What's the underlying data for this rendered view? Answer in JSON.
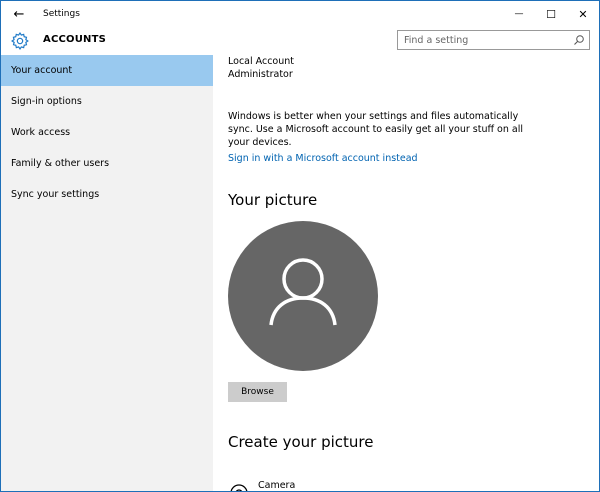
{
  "titlebar": {
    "title": "Settings",
    "back_glyph": "←",
    "minimize_glyph": "—",
    "maximize_glyph": "☐",
    "close_glyph": "✕"
  },
  "header": {
    "section_title": "ACCOUNTS",
    "icon": "gear-icon",
    "search_placeholder": "Find a setting"
  },
  "sidebar": {
    "items": [
      {
        "label": "Your account",
        "active": true
      },
      {
        "label": "Sign-in options",
        "active": false
      },
      {
        "label": "Work access",
        "active": false
      },
      {
        "label": "Family & other users",
        "active": false
      },
      {
        "label": "Sync your settings",
        "active": false
      }
    ]
  },
  "main": {
    "account_type": "Local Account",
    "account_role": "Administrator",
    "sync_text": "Windows is better when your settings and files automatically sync. Use a Microsoft account to easily get all your stuff on all your devices.",
    "signin_link": "Sign in with a Microsoft account instead",
    "your_picture_heading": "Your picture",
    "browse_label": "Browse",
    "create_picture_heading": "Create your picture",
    "camera_label": "Camera"
  },
  "colors": {
    "accent": "#0063b1",
    "sidebar_active": "#99c9ef",
    "sidebar_bg": "#f2f2f2",
    "avatar_bg": "#666666",
    "gear": "#1e79c7"
  }
}
